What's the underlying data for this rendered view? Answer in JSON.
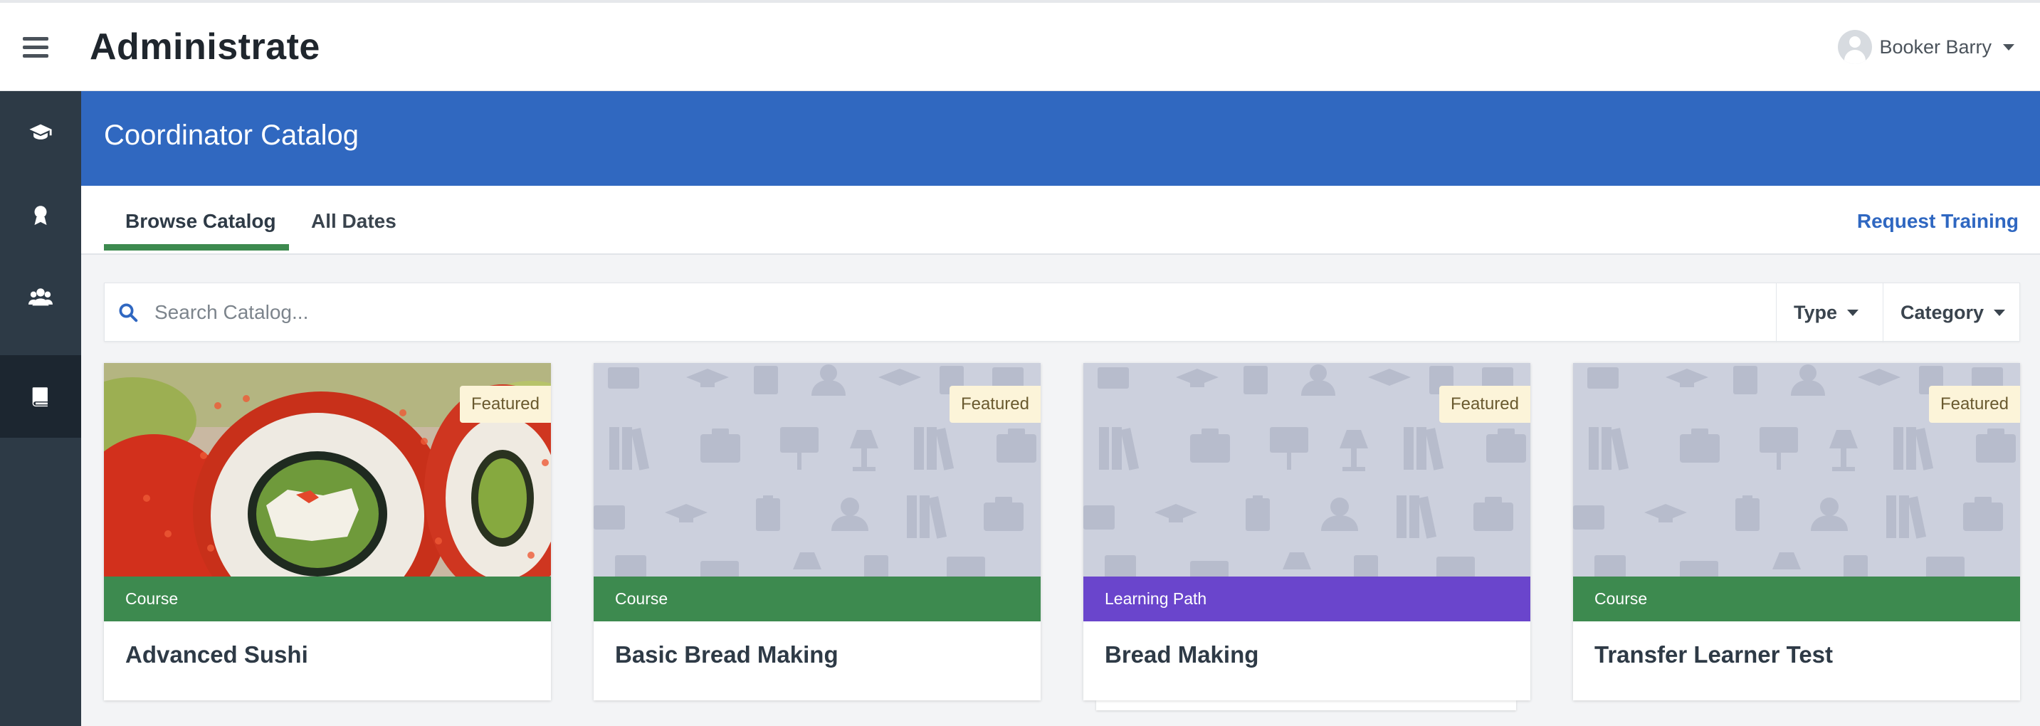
{
  "app": {
    "title": "Administrate"
  },
  "user": {
    "name": "Booker Barry"
  },
  "sidebar": {
    "items": [
      {
        "icon": "graduation-cap-icon",
        "active": false
      },
      {
        "icon": "award-icon",
        "active": false
      },
      {
        "icon": "users-icon",
        "active": false
      },
      {
        "icon": "book-icon",
        "active": true
      }
    ]
  },
  "page": {
    "title": "Coordinator Catalog"
  },
  "tabs": [
    {
      "label": "Browse Catalog",
      "active": true
    },
    {
      "label": "All Dates",
      "active": false
    }
  ],
  "request_training_label": "Request Training",
  "search": {
    "placeholder": "Search Catalog..."
  },
  "filters": {
    "type_label": "Type",
    "category_label": "Category"
  },
  "cards": [
    {
      "badge": "Featured",
      "type": "Course",
      "type_color": "#3d8a4f",
      "title": "Advanced Sushi",
      "image": "sushi-photo"
    },
    {
      "badge": "Featured",
      "type": "Course",
      "type_color": "#3d8a4f",
      "title": "Basic Bread Making",
      "image": "placeholder-pattern"
    },
    {
      "badge": "Featured",
      "type": "Learning Path",
      "type_color": "#6a45cc",
      "title": "Bread Making",
      "image": "placeholder-pattern"
    },
    {
      "badge": "Featured",
      "type": "Course",
      "type_color": "#3d8a4f",
      "title": "Transfer Learner Test",
      "image": "placeholder-pattern"
    }
  ],
  "colors": {
    "header_blue": "#3068c0",
    "sidebar_dark": "#2d3a46",
    "tab_underline_green": "#3d8a4f",
    "link_blue": "#2f67c1",
    "featured_bg": "#fcf4d9"
  }
}
